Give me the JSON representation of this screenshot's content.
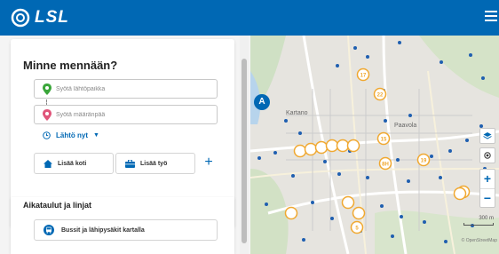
{
  "header": {
    "logo_text": "LSL",
    "brand_color": "#0068b4"
  },
  "journey": {
    "title": "Minne mennään?",
    "origin_placeholder": "Syötä lähtöpaikka",
    "destination_placeholder": "Syötä määränpää",
    "time_label": "Lähtö nyt",
    "home_label": "Lisää koti",
    "work_label": "Lisää työ",
    "add_label": "+"
  },
  "timetables": {
    "title": "Aikataulut ja linjat",
    "nearby_label": "Bussit ja lähipysäkit kartalla"
  },
  "map": {
    "position_marker": "A",
    "place_labels": [
      "Kartano",
      "Paavola"
    ],
    "stop_badges": [
      "17",
      "22",
      "15",
      "19",
      "8H",
      "2",
      "5"
    ],
    "zoom_in": "+",
    "zoom_out": "−",
    "scale": "300 m",
    "attribution": "© OpenStreetMap"
  },
  "colors": {
    "accent": "#0068b4",
    "stop": "#f0a830",
    "origin_pin": "#3aa63a",
    "destination_pin": "#e0557a"
  },
  "icons": [
    "logo-ring-icon",
    "menu-icon",
    "origin-pin-icon",
    "destination-pin-icon",
    "clock-icon",
    "chevron-down-icon",
    "home-icon",
    "briefcase-icon",
    "plus-icon",
    "bus-icon",
    "layers-icon",
    "locate-icon"
  ]
}
